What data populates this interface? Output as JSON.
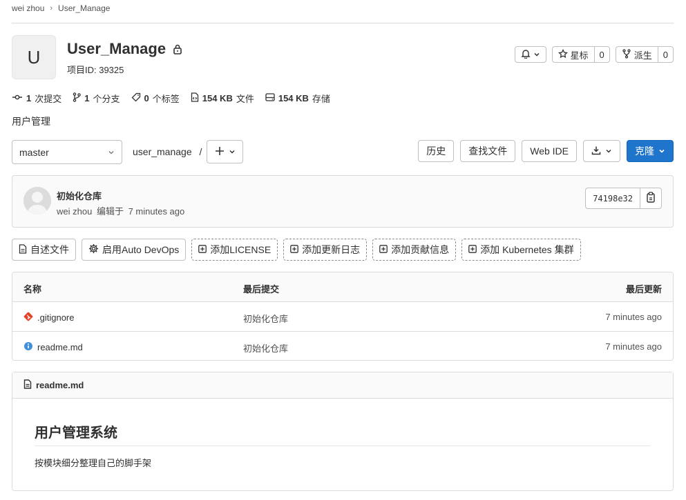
{
  "breadcrumb": {
    "owner": "wei zhou",
    "separator": "›",
    "project": "User_Manage"
  },
  "project": {
    "avatar_letter": "U",
    "name": "User_Manage",
    "id_label": "项目ID: 39325"
  },
  "actions": {
    "star_label": "星标",
    "star_count": "0",
    "fork_label": "派生",
    "fork_count": "0"
  },
  "stats": {
    "commits_num": "1",
    "commits_label": "次提交",
    "branches_num": "1",
    "branches_label": "个分支",
    "tags_num": "0",
    "tags_label": "个标签",
    "files_num": "154 KB",
    "files_label": "文件",
    "storage_num": "154 KB",
    "storage_label": "存储"
  },
  "description": "用户管理",
  "toolbar": {
    "branch": "master",
    "path": "user_manage",
    "path_sep": "/",
    "history": "历史",
    "find_file": "查找文件",
    "web_ide": "Web IDE",
    "clone": "克隆"
  },
  "commit": {
    "title": "初始化仓库",
    "author": "wei zhou",
    "action": "编辑于",
    "time": "7 minutes ago",
    "sha": "74198e32"
  },
  "quick_links": {
    "readme": "自述文件",
    "devops": "启用Auto DevOps",
    "license": "添加LICENSE",
    "changelog": "添加更新日志",
    "contributing": "添加贡献信息",
    "k8s": "添加 Kubernetes 集群"
  },
  "files": {
    "headers": {
      "name": "名称",
      "last_commit": "最后提交",
      "last_update": "最后更新"
    },
    "rows": [
      {
        "name": ".gitignore",
        "commit": "初始化仓库",
        "updated": "7 minutes ago"
      },
      {
        "name": "readme.md",
        "commit": "初始化仓库",
        "updated": "7 minutes ago"
      }
    ]
  },
  "readme": {
    "filename": "readme.md",
    "heading": "用户管理系统",
    "body": "按模块细分整理自己的脚手架"
  },
  "colors": {
    "primary": "#1f75cb",
    "gitignore": "#e24329",
    "info": "#428fdc"
  }
}
